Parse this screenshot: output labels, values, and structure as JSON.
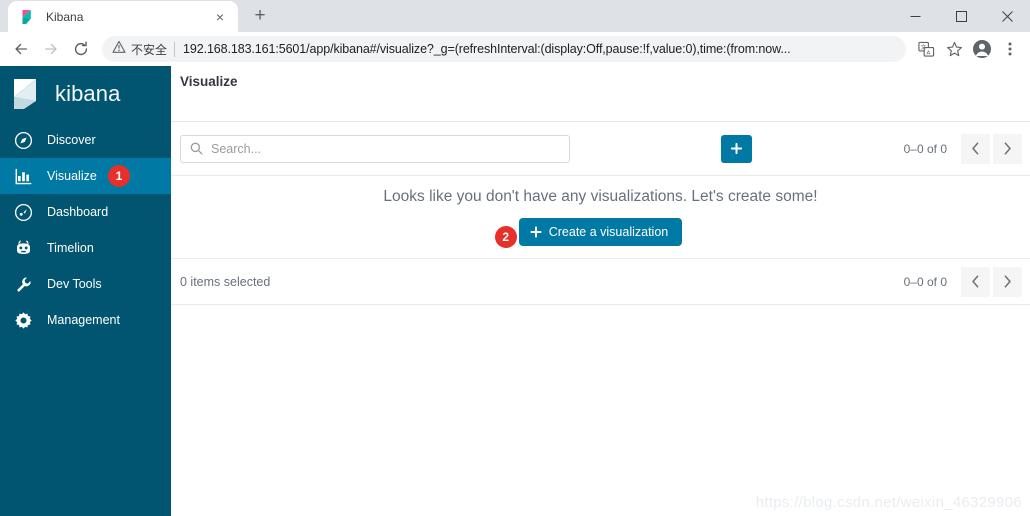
{
  "browser": {
    "tab": {
      "title": "Kibana",
      "favicon": "kibana-favicon",
      "close_label": "×"
    },
    "new_tab_label": "+",
    "window_controls": {
      "minimize": "minimize-icon",
      "maximize": "maximize-icon",
      "close": "close-icon"
    },
    "nav": {
      "back": "back-arrow-icon",
      "forward": "forward-arrow-icon",
      "reload": "reload-icon"
    },
    "omnibox": {
      "security_label": "不安全",
      "url": "192.168.183.161:5601/app/kibana#/visualize?_g=(refreshInterval:(display:Off,pause:!f,value:0),time:(from:now...",
      "url_host": "192.168.183.161:5601",
      "url_rest": "/app/kibana#/visualize?_g=(refreshInterval:(display:Off,pause:!f,value:0),time:(from:now..."
    },
    "toolbar_icons": {
      "translate": "translate-icon",
      "bookmark": "star-icon",
      "profile": "account-avatar-icon",
      "menu": "three-dot-menu-icon"
    }
  },
  "sidebar": {
    "brand": "kibana",
    "brand_mark": "kibana-logo",
    "background": "#015571",
    "active_background": "#0079a5",
    "items": [
      {
        "label": "Discover",
        "icon": "compass-icon",
        "active": false
      },
      {
        "label": "Visualize",
        "icon": "bar-chart-icon",
        "active": true,
        "badge": "1"
      },
      {
        "label": "Dashboard",
        "icon": "dashboard-icon",
        "active": false
      },
      {
        "label": "Timelion",
        "icon": "timelion-icon",
        "active": false
      },
      {
        "label": "Dev Tools",
        "icon": "wrench-icon",
        "active": false
      },
      {
        "label": "Management",
        "icon": "gear-icon",
        "active": false
      }
    ]
  },
  "page": {
    "title": "Visualize"
  },
  "toolbar": {
    "search_placeholder": "Search...",
    "search_value": "",
    "search_icon": "search-icon",
    "add_button_label": "+",
    "pagination_text": "0–0 of 0",
    "prev_label": "‹",
    "next_label": "›"
  },
  "empty_state": {
    "message": "Looks like you don't have any visualizations. Let's create some!",
    "create_button_label": "Create a visualization",
    "create_button_plus": "+",
    "badge": "2"
  },
  "footer": {
    "selection_text": "0 items selected",
    "pagination_text": "0–0 of 0",
    "prev_label": "‹",
    "next_label": "›"
  },
  "watermark": {
    "text": "https://blog.csdn.net/weixin_46329906"
  },
  "colors": {
    "accent_blue": "#0079a5",
    "sidebar_dark": "#015571",
    "badge_red": "#e8302a",
    "text_muted": "#69707d"
  }
}
